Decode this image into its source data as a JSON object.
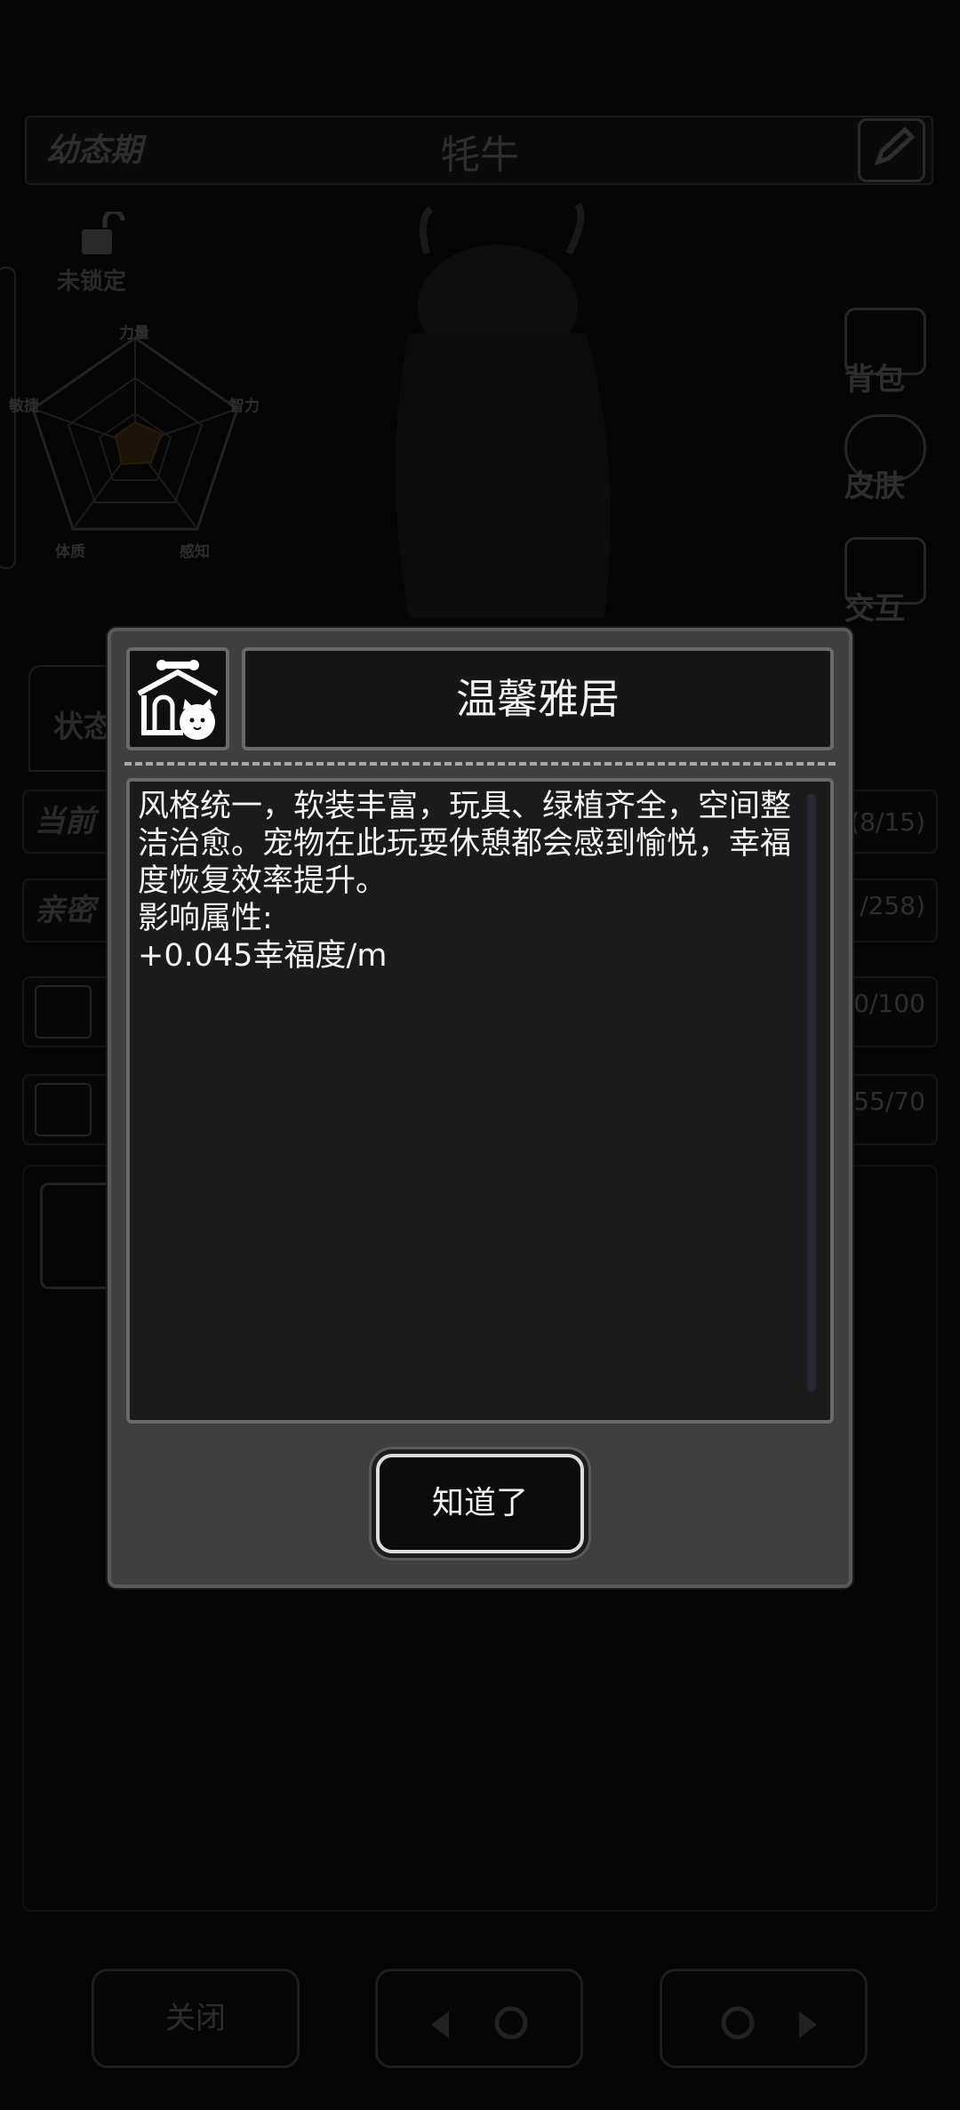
{
  "background": {
    "stage_label": "幼态期",
    "pet_name": "牦牛",
    "lock_label": "未锁定",
    "radar": {
      "top": "力量",
      "right": "智力",
      "left": "敏捷",
      "bottom_left": "体质",
      "bottom_right": "感知"
    },
    "side_buttons": [
      "背包",
      "皮肤",
      "交互"
    ],
    "tab_status": "状态",
    "stats": [
      {
        "label": "当前",
        "value": "(8/15)"
      },
      {
        "label": "亲密",
        "value": "/258)"
      },
      {
        "label": "",
        "value": "00/100"
      },
      {
        "label": "",
        "value": "55/70"
      }
    ],
    "bottom": {
      "close_label": "关闭"
    }
  },
  "modal": {
    "title": "温馨雅居",
    "icon": "pet-house-icon",
    "description": "风格统一，软装丰富，玩具、绿植齐全，空间整洁治愈。宠物在此玩耍休憩都会感到愉悦，幸福度恢复效率提升。\n影响属性:\n+0.045幸福度/m",
    "confirm_label": "知道了"
  }
}
